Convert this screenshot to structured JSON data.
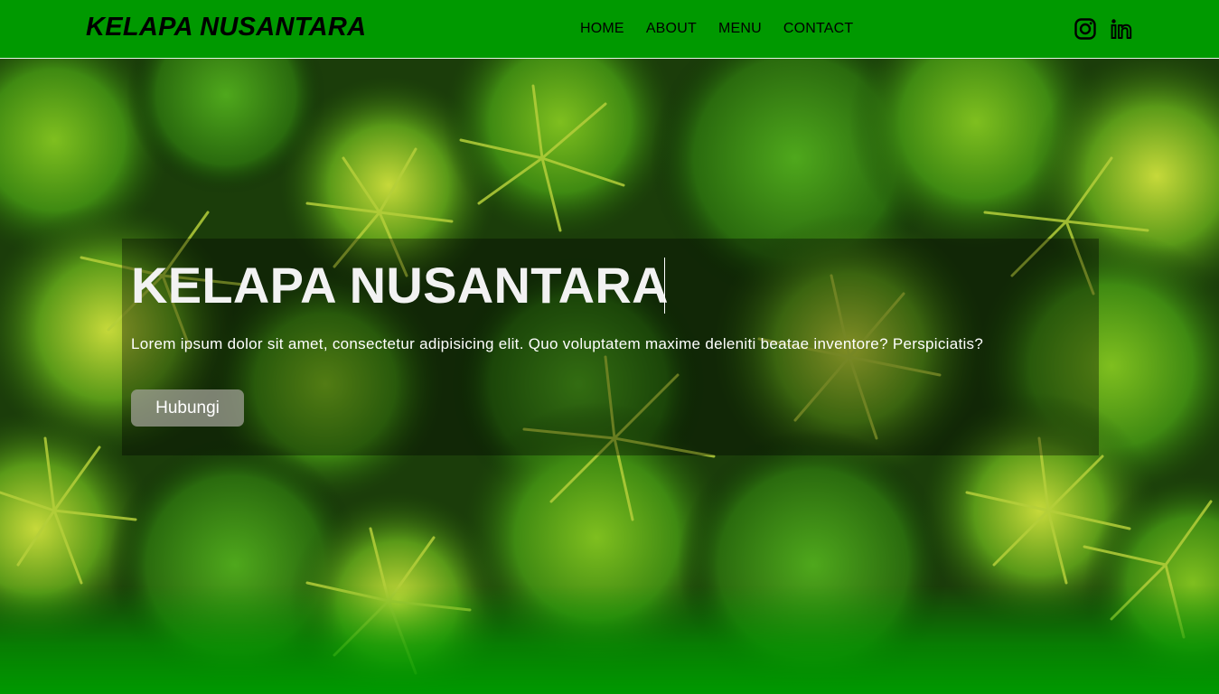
{
  "navbar": {
    "brand": "KELAPA NUSANTARA",
    "links": [
      "HOME",
      "ABOUT",
      "MENU",
      "CONTACT"
    ],
    "social_icons": [
      "instagram-icon",
      "linkedin-icon"
    ],
    "background_color": "#009900"
  },
  "hero": {
    "title": "KELAPA NUSANTARA",
    "description": "Lorem ipsum dolor sit amet, consectetur adipisicing elit. Quo voluptatem maxime deleniti beatae inventore? Perspiciatis?",
    "button_label": "Hubungi",
    "background": "aerial view of tropical palm forest"
  }
}
